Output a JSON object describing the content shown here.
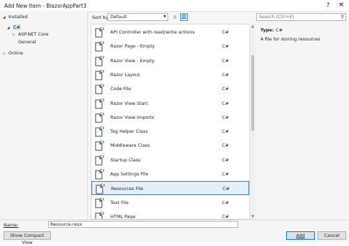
{
  "window": {
    "title": "Add New Item - BlazorAppPart3",
    "help_label": "?",
    "close_label": "✕"
  },
  "tree": {
    "installed": "Installed",
    "csharp": "C#",
    "aspnet": "ASP.NET Core",
    "general": "General",
    "online": "Online"
  },
  "toolbar": {
    "sort_label": "Sort by:",
    "sort_value": "Default",
    "search_placeholder": "Search (Ctrl+E)"
  },
  "templates": [
    {
      "name": "API Controller with read/write actions",
      "lang": "C#",
      "icon": "api-controller-icon"
    },
    {
      "name": "Razor Page - Empty",
      "lang": "C#",
      "icon": "razor-page-icon"
    },
    {
      "name": "Razor View - Empty",
      "lang": "C#",
      "icon": "razor-view-icon"
    },
    {
      "name": "Razor Layout",
      "lang": "C#",
      "icon": "razor-layout-icon"
    },
    {
      "name": "Code File",
      "lang": "C#",
      "icon": "code-file-icon"
    },
    {
      "name": "Razor View Start",
      "lang": "C#",
      "icon": "razor-view-start-icon"
    },
    {
      "name": "Razor View Imports",
      "lang": "C#",
      "icon": "razor-view-imports-icon"
    },
    {
      "name": "Tag Helper Class",
      "lang": "C#",
      "icon": "tag-helper-icon"
    },
    {
      "name": "Middleware Class",
      "lang": "C#",
      "icon": "middleware-class-icon"
    },
    {
      "name": "Startup Class",
      "lang": "C#",
      "icon": "startup-class-icon"
    },
    {
      "name": "App Settings File",
      "lang": "C#",
      "icon": "app-settings-icon"
    },
    {
      "name": "Resources File",
      "lang": "C#",
      "icon": "resources-file-icon",
      "selected": true
    },
    {
      "name": "Text File",
      "lang": "C#",
      "icon": "text-file-icon"
    },
    {
      "name": "HTML Page",
      "lang": "C#",
      "icon": "html-page-icon"
    }
  ],
  "details": {
    "type_label": "Type:",
    "type_value": "C#",
    "description": "A file for storing resources"
  },
  "footer": {
    "name_label": "Name:",
    "name_value": "Resource.resx",
    "compact_view": "Show Compact View",
    "add": "Add",
    "cancel": "Cancel"
  },
  "colors": {
    "selection_bg": "#e5effa",
    "selection_border": "#3e75c5",
    "csharp_badge": "#2c8b3c",
    "accent": "#0078d7"
  }
}
